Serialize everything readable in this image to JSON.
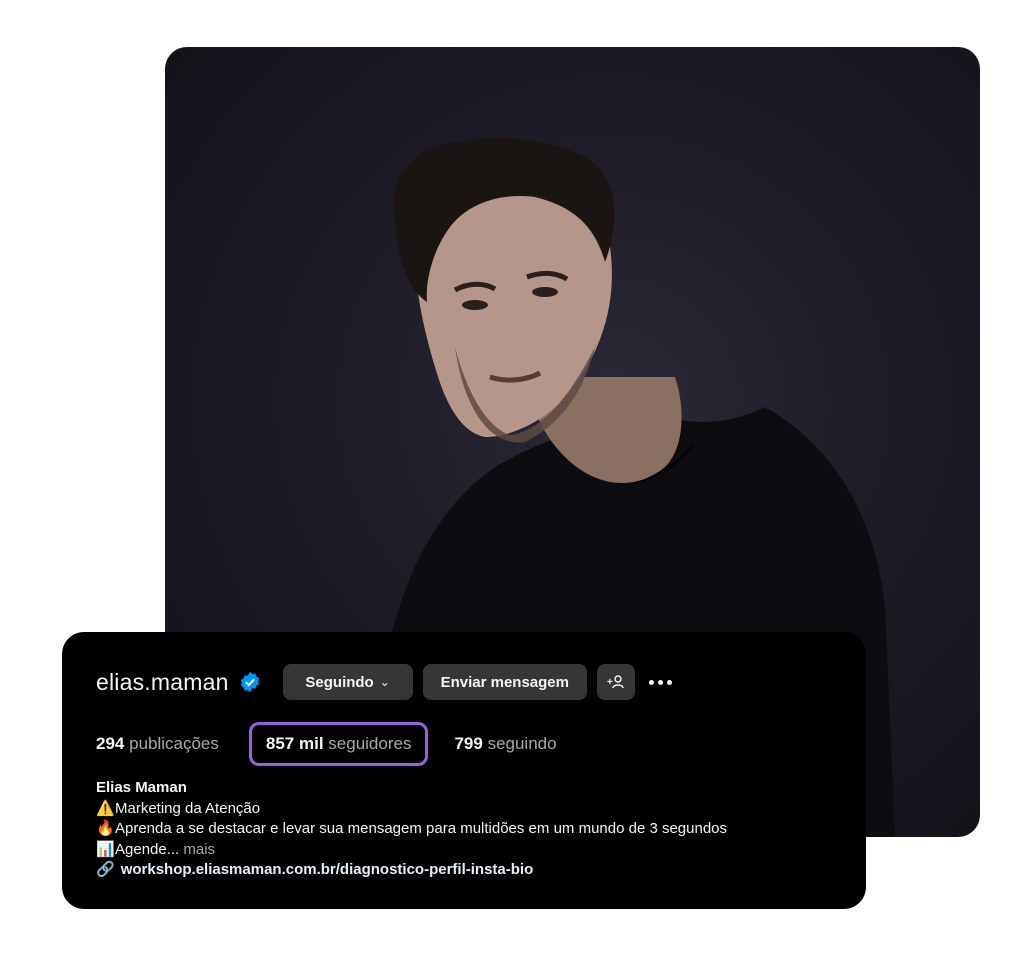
{
  "profile": {
    "username": "elias.maman",
    "following_label": "Seguindo",
    "message_label": "Enviar mensagem",
    "add_user_label": "+",
    "stats": {
      "posts_count": "294",
      "posts_label": "publicações",
      "followers_count": "857 mil",
      "followers_label": "seguidores",
      "following_count": "799",
      "following_label": "seguindo"
    },
    "bio": {
      "name": "Elias Maman",
      "line1_emoji": "⚠️",
      "line1": "Marketing da Atenção",
      "line2_emoji": "🔥",
      "line2": "Aprenda a se destacar e levar sua mensagem para multidões em um mundo de 3 segundos",
      "line3_emoji": "📊",
      "line3": "Agende...",
      "more": "mais",
      "link_icon": "🔗",
      "link": "workshop.eliasmaman.com.br/diagnostico-perfil-insta-bio"
    }
  },
  "colors": {
    "highlight": "#9b5fe0",
    "verified": "#0095f6",
    "button_bg": "#363636"
  }
}
